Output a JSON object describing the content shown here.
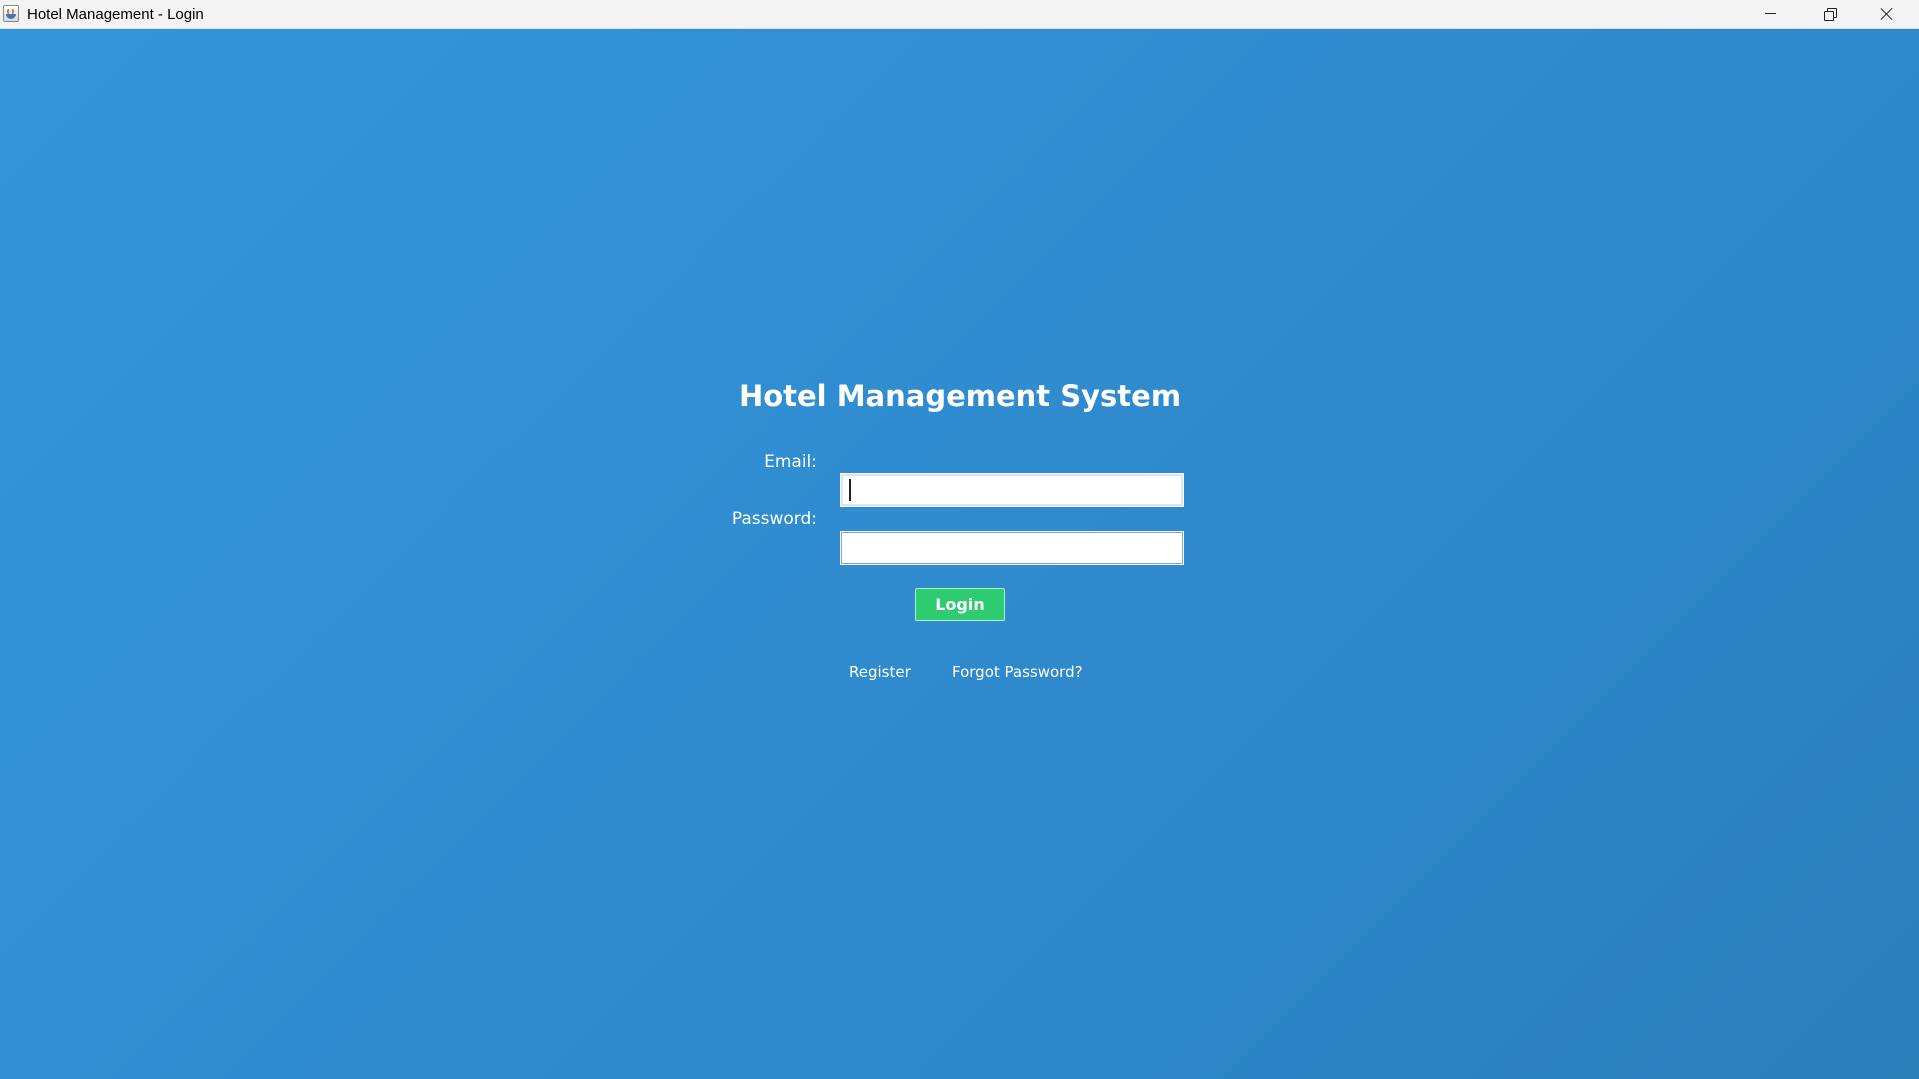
{
  "window": {
    "title": "Hotel Management - Login",
    "icon": "java-app-icon",
    "controls": [
      "minimize-icon",
      "restore-icon",
      "close-icon"
    ]
  },
  "login": {
    "heading": "Hotel Management System",
    "email_label": "Email:",
    "email_value": "",
    "password_label": "Password:",
    "password_value": "",
    "login_button": "Login",
    "register_link": "Register",
    "forgot_password_link": "Forgot Password?"
  },
  "colors": {
    "background_start": "#3396db",
    "background_end": "#2a7fbb",
    "login_button": "#2ecc71",
    "text": "#ffffff"
  }
}
